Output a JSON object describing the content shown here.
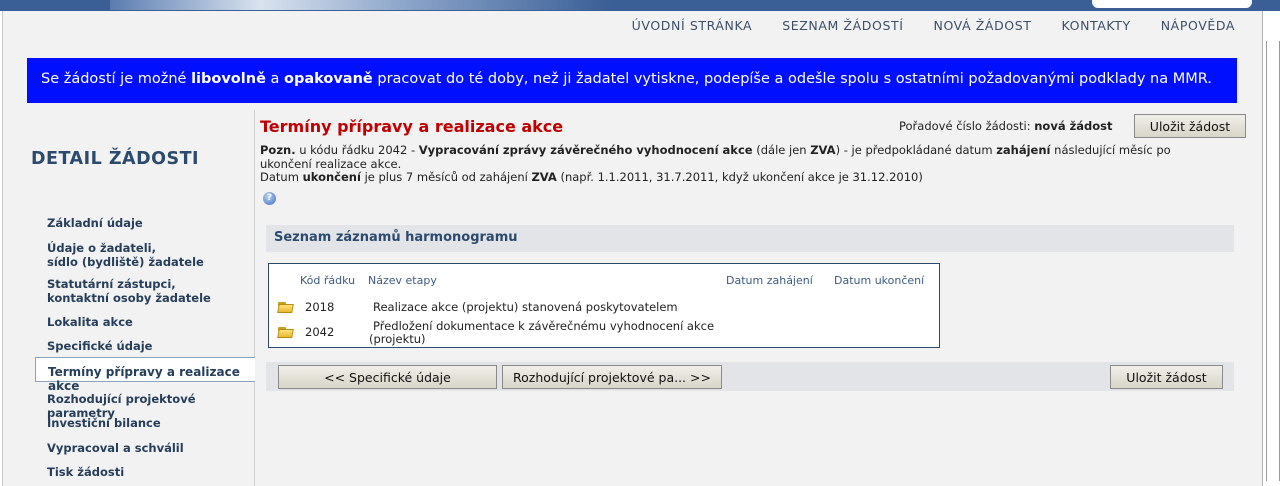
{
  "topnav": [
    "ÚVODNÍ STRÁNKA",
    "SEZNAM ŽÁDOSTÍ",
    "NOVÁ ŽÁDOST",
    "KONTAKTY",
    "NÁPOVĚDA"
  ],
  "infobar": {
    "part1": "Se žádostí je možné ",
    "bold1": "libovolně",
    "part2": " a ",
    "bold2": "opakovaně",
    "part3": " pracovat do té doby, než ji žadatel vytiskne, podepíše a odešle spolu s ostatními požadovanými podklady na MMR."
  },
  "sidebar": {
    "title": "DETAIL ŽÁDOSTI",
    "items": [
      "Základní údaje",
      "Údaje o žadateli,\nsídlo (bydliště) žadatele",
      "Statutární zástupci,\nkontaktní osoby žadatele",
      "Lokalita akce",
      "Specifické údaje",
      "Termíny přípravy a realizace akce",
      "Rozhodující projektové parametry",
      "Investiční bilance",
      "Vypracoval a schválil",
      "Tisk žádosti"
    ]
  },
  "content": {
    "title": "Termíny přípravy a realizace akce",
    "order_label": "Pořadové číslo žádosti:",
    "order_value": "nová žádost",
    "save_label": "Uložit žádost",
    "note": {
      "pozn": "Pozn.",
      "t1": " u kódu řádku 2042 - ",
      "b1": "Vypracování zprávy závěrečného vyhodnocení akce",
      "t2": " (dále jen ",
      "b2": "ZVA",
      "t3": ") - je předpokládané datum ",
      "b3": "zahájení",
      "t4": " následující měsíc po ukončení realizace akce.",
      "t5": "Datum ",
      "b4": "ukončení",
      "t6": " je plus 7 měsíců od zahájení ",
      "b5": "ZVA",
      "t7": " (např. 1.1.2011, 31.7.2011, když ukončení akce je 31.12.2010)"
    },
    "help_icon": "?",
    "section_title": "Seznam záznamů harmonogramu",
    "columns": [
      "Kód řádku",
      "Název etapy",
      "Datum zahájení",
      "Datum ukončení"
    ],
    "rows": [
      {
        "code": "2018",
        "name": "Realizace akce (projektu) stanovená poskytovatelem",
        "start": "",
        "end": ""
      },
      {
        "code": "2042",
        "name": "Předložení dokumentace k závěrečnému vyhodnocení akce (projektu)",
        "start": "",
        "end": ""
      }
    ],
    "prev_label": "<<  Specifické údaje",
    "next_label": "Rozhodující projektové pa...  >>"
  }
}
